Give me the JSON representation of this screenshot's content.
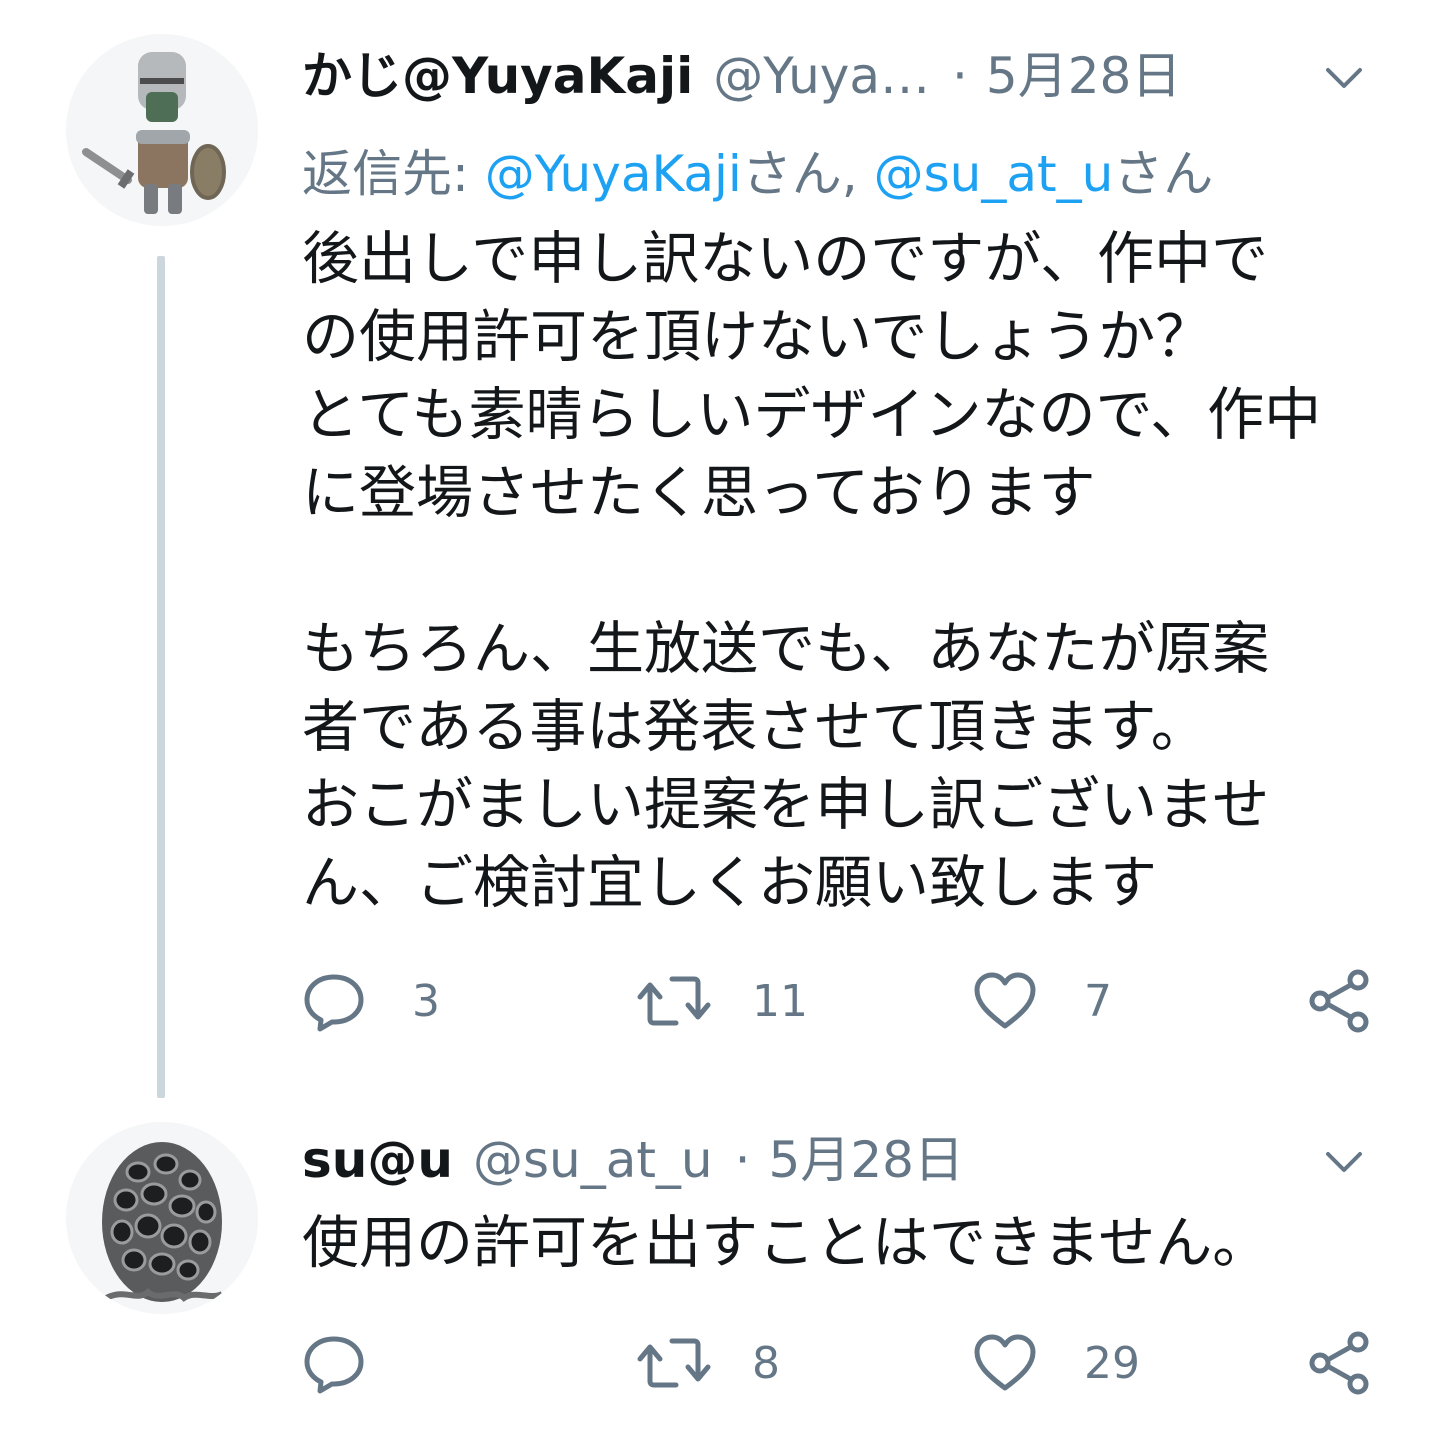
{
  "tweets": [
    {
      "author": {
        "name": "かじ@YuyaKaji",
        "handle": "@Yuya…",
        "avatar": "armored-knight-avatar"
      },
      "separator": "·",
      "date": "5月28日",
      "reply_to": {
        "prefix": "返信先: ",
        "mention1": "@YuyaKaji",
        "suffix1": "さん, ",
        "mention2": "@su_at_u",
        "suffix2": "さん"
      },
      "text": [
        "後出しで申し訳ないのですが、作中で",
        "の使用許可を頂けないでしょうか？",
        "とても素晴らしいデザインなので、作中",
        "に登場させたく思っております",
        "",
        "もちろん、生放送でも、あなたが原案",
        "者である事は発表させて頂きます。",
        "おこがましい提案を申し訳ございませ",
        "ん、ご検討宜しくお願い致します"
      ],
      "actions": {
        "reply_count": "3",
        "retweet_count": "11",
        "like_count": "7"
      }
    },
    {
      "author": {
        "name": "su@u",
        "handle": "@su_at_u",
        "avatar": "lattice-egg-creature-avatar"
      },
      "separator": "·",
      "date": "5月28日",
      "text": [
        "使用の許可を出すことはできません。"
      ],
      "actions": {
        "reply_count": "",
        "retweet_count": "8",
        "like_count": "29"
      }
    }
  ],
  "colors": {
    "text": "#14171a",
    "secondary": "#657786",
    "link": "#1da1f2",
    "thread_line": "#ccd6dd"
  },
  "icons": {
    "reply": "reply-bubble-icon",
    "retweet": "retweet-icon",
    "like": "heart-icon",
    "share": "share-icon",
    "menu": "chevron-down-icon"
  }
}
